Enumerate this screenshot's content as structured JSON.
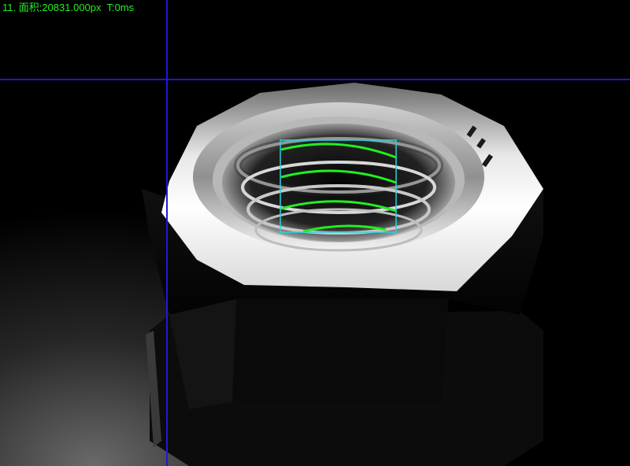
{
  "overlay": {
    "measurement_text": "11. 面积:20831.000px  T:0ms"
  },
  "colors": {
    "crosshair": "#1a1adc",
    "roi": "#2ad4dc",
    "detection": "#22ee22",
    "background": "#000000"
  },
  "icons": {
    "nut": "hex-nut-image"
  }
}
